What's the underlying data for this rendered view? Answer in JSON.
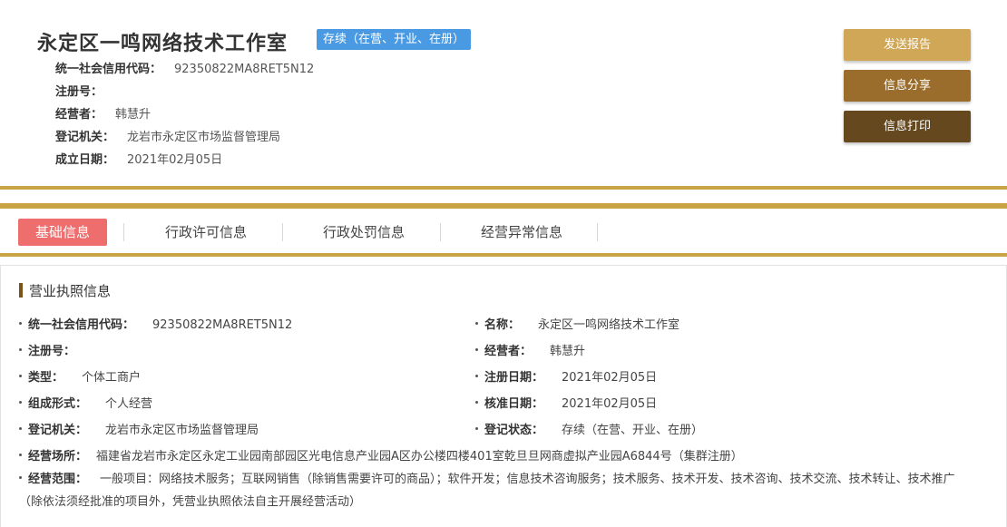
{
  "company": {
    "name": "永定区一鸣网络技术工作室",
    "status": "存续（在营、开业、在册）",
    "meta": [
      {
        "label": "统一社会信用代码：",
        "value": "92350822MA8RET5N12"
      },
      {
        "label": "注册号：",
        "value": ""
      },
      {
        "label": "经营者：",
        "value": "韩慧升"
      },
      {
        "label": "登记机关：",
        "value": "龙岩市永定区市场监督管理局"
      },
      {
        "label": "成立日期：",
        "value": "2021年02月05日"
      }
    ]
  },
  "actions": {
    "send_report": "发送报告",
    "share": "信息分享",
    "print": "信息打印"
  },
  "colors": {
    "badge": "#4a9ae3",
    "gold_line": "#c9a445",
    "active_tab": "#ee6e6e",
    "btn_report": "#cfa757",
    "btn_share": "#9b6d2c",
    "btn_print": "#65481e"
  },
  "tabs": [
    {
      "label": "基础信息",
      "active": true
    },
    {
      "label": "行政许可信息",
      "active": false
    },
    {
      "label": "行政处罚信息",
      "active": false
    },
    {
      "label": "经营异常信息",
      "active": false
    }
  ],
  "license": {
    "title": "营业执照信息",
    "left": [
      {
        "label": "统一社会信用代码：",
        "value": "92350822MA8RET5N12"
      },
      {
        "label": "注册号：",
        "value": ""
      },
      {
        "label": "类型：",
        "value": "个体工商户"
      },
      {
        "label": "组成形式：",
        "value": "个人经营"
      },
      {
        "label": "登记机关：",
        "value": "龙岩市永定区市场监督管理局"
      }
    ],
    "right": [
      {
        "label": "名称：",
        "value": "永定区一鸣网络技术工作室"
      },
      {
        "label": "经营者：",
        "value": "韩慧升"
      },
      {
        "label": "注册日期：",
        "value": "2021年02月05日"
      },
      {
        "label": "核准日期：",
        "value": "2021年02月05日"
      },
      {
        "label": "登记状态：",
        "value": "存续（在营、开业、在册）"
      }
    ],
    "address": {
      "label": "经营场所：",
      "value": "福建省龙岩市永定区永定工业园南部园区光电信息产业园A区办公楼四楼401室乾旦旦网商虚拟产业园A6844号（集群注册）"
    },
    "scope": {
      "label": "经营范围：",
      "value": "一般项目：网络技术服务；互联网销售（除销售需要许可的商品）；软件开发；信息技术咨询服务；技术服务、技术开发、技术咨询、技术交流、技术转让、技术推广（除依法须经批准的项目外，凭营业执照依法自主开展经营活动）"
    }
  }
}
